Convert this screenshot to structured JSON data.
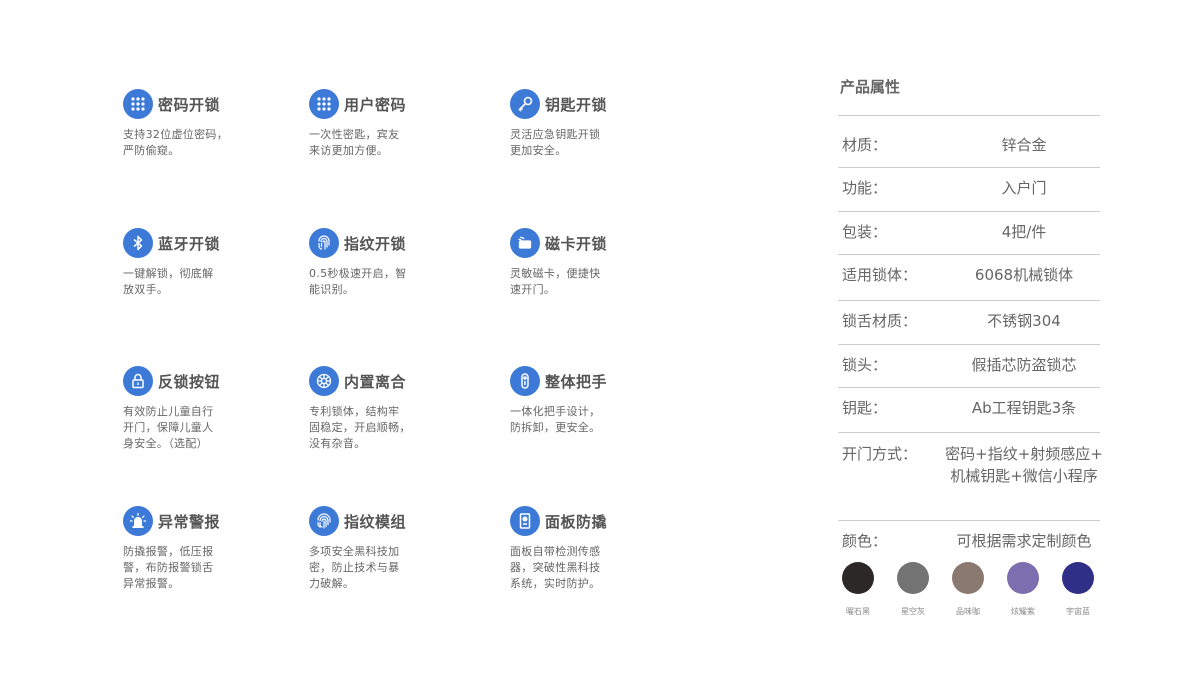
{
  "features": [
    {
      "title": "密码开锁",
      "desc": "支持32位虚位密码，\n严防偷窥。",
      "icon": "keypad-icon"
    },
    {
      "title": "用户密码",
      "desc": "一次性密匙，宾友\n来访更加方便。",
      "icon": "keypad-icon"
    },
    {
      "title": "钥匙开锁",
      "desc": "灵活应急钥匙开锁\n更加安全。",
      "icon": "key-icon"
    },
    {
      "title": "蓝牙开锁",
      "desc": "一键解锁，彻底解\n放双手。",
      "icon": "bluetooth-icon"
    },
    {
      "title": "指纹开锁",
      "desc": "0.5秒极速开启，智\n能识别。",
      "icon": "fingerprint-icon"
    },
    {
      "title": "磁卡开锁",
      "desc": "灵敏磁卡，便捷快\n速开门。",
      "icon": "card-icon"
    },
    {
      "title": "反锁按钮",
      "desc": "有效防止儿童自行\n开门，保障儿童人\n身安全。（选配）",
      "icon": "lock-icon"
    },
    {
      "title": "内置离合",
      "desc": "专利锁体，结构牢\n固稳定，开启顺畅，\n没有杂音。",
      "icon": "gear-icon"
    },
    {
      "title": "整体把手",
      "desc": "一体化把手设计，\n防拆卸，更安全。",
      "icon": "handle-icon"
    },
    {
      "title": "异常警报",
      "desc": "防撬报警，低压报\n警，布防报警锁舌\n异常报警。",
      "icon": "alarm-icon"
    },
    {
      "title": "指纹模组",
      "desc": "多项安全黑科技加\n密，防止技术与暴\n力破解。",
      "icon": "fingerprint-icon"
    },
    {
      "title": "面板防撬",
      "desc": "面板自带检测传感\n器，突破性黑科技\n系统，实时防护。",
      "icon": "panel-icon"
    }
  ],
  "properties": {
    "title": "产品属性",
    "rows": [
      {
        "label": "材质：",
        "value": "锌合金"
      },
      {
        "label": "功能：",
        "value": "入户门"
      },
      {
        "label": "包装：",
        "value": "4把/件"
      },
      {
        "label": "适用锁体：",
        "value": "6068机械锁体"
      },
      {
        "label": "锁舌材质：",
        "value": "不锈钢304"
      },
      {
        "label": "锁头：",
        "value": "假插芯防盗锁芯"
      },
      {
        "label": "钥匙：",
        "value": "Ab工程钥匙3条"
      },
      {
        "label": "开门方式：",
        "value": "密码+指纹+射频感应+\n机械钥匙+微信小程序"
      }
    ],
    "color_row": {
      "label": "颜色：",
      "value": "可根据需求定制颜色"
    },
    "swatches": [
      {
        "name": "曜石黑",
        "color": "#2d2828"
      },
      {
        "name": "星空灰",
        "color": "#737373"
      },
      {
        "name": "品味咖",
        "color": "#8a7970"
      },
      {
        "name": "炫耀紫",
        "color": "#7b6fb0"
      },
      {
        "name": "宇宙蓝",
        "color": "#2f2f88"
      }
    ]
  },
  "colors": {
    "accent": "#3d7ad8"
  }
}
